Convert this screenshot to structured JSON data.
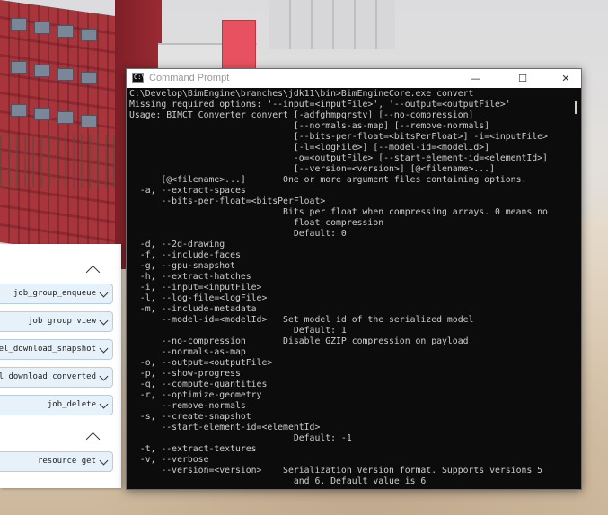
{
  "window": {
    "title": "Command Prompt",
    "icon_text": "C:\\",
    "minimize": "—",
    "maximize": "☐",
    "close": "✕"
  },
  "console_lines": [
    "C:\\Develop\\BimEngine\\branches\\jdk11\\bin>BimEngineCore.exe convert",
    "Missing required options: '--input=<inputFile>', '--output=<outputFile>'",
    "Usage: BIMCT Converter convert [-adfghmpqrstv] [--no-compression]",
    "                               [--normals-as-map] [--remove-normals]",
    "                               [--bits-per-float=<bitsPerFloat>] -i=<inputFile>",
    "                               [-l=<logFile>] [--model-id=<modelId>]",
    "                               -o=<outputFile> [--start-element-id=<elementId>]",
    "                               [--version=<version>] [@<filename>...]",
    "      [@<filename>...]       One or more argument files containing options.",
    "  -a, --extract-spaces",
    "      --bits-per-float=<bitsPerFloat>",
    "                             Bits per float when compressing arrays. 0 means no",
    "                               float compression",
    "                               Default: 0",
    "  -d, --2d-drawing",
    "  -f, --include-faces",
    "  -g, --gpu-snapshot",
    "  -h, --extract-hatches",
    "  -i, --input=<inputFile>",
    "  -l, --log-file=<logFile>",
    "  -m, --include-metadata",
    "      --model-id=<modelId>   Set model id of the serialized model",
    "                               Default: 1",
    "      --no-compression       Disable GZIP compression on payload",
    "      --normals-as-map",
    "  -o, --output=<outputFile>",
    "  -p, --show-progress",
    "  -q, --compute-quantities",
    "  -r, --optimize-geometry",
    "      --remove-normals",
    "  -s, --create-snapshot",
    "      --start-element-id=<elementId>",
    "                               Default: -1",
    "  -t, --extract-textures",
    "  -v, --verbose",
    "      --version=<version>    Serialization Version format. Supports versions 5",
    "                               and 6. Default value is 6"
  ],
  "panel": {
    "jobs": [
      {
        "label": "job_group_enqueue"
      },
      {
        "label": "job group view"
      },
      {
        "label": "odel_download_snapshot"
      },
      {
        "label": "odel_download_converted"
      },
      {
        "label": "job_delete"
      },
      {
        "label": "resource get"
      }
    ]
  },
  "colors": {
    "console_bg": "#0c0c0c",
    "console_text": "#cccccc",
    "job_button_bg": "#e6f1fa",
    "building_red": "#a8343c",
    "pink_block": "#e85260"
  }
}
